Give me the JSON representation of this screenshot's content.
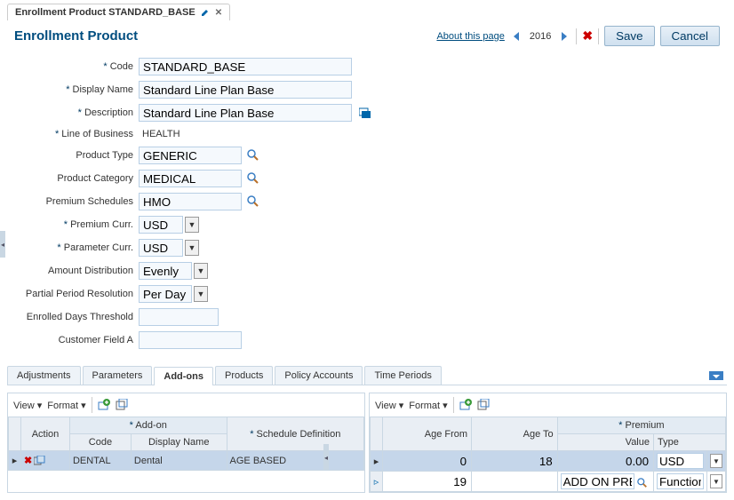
{
  "tab": {
    "title": "Enrollment Product STANDARD_BASE"
  },
  "header": {
    "title": "Enrollment Product",
    "about": "About this page",
    "year": "2016",
    "save": "Save",
    "cancel": "Cancel"
  },
  "form": {
    "code": {
      "label": "Code",
      "value": "STANDARD_BASE"
    },
    "display_name": {
      "label": "Display Name",
      "value": "Standard Line Plan Base"
    },
    "description": {
      "label": "Description",
      "value": "Standard Line Plan Base"
    },
    "lob": {
      "label": "Line of Business",
      "value": "HEALTH"
    },
    "product_type": {
      "label": "Product Type",
      "value": "GENERIC"
    },
    "product_category": {
      "label": "Product Category",
      "value": "MEDICAL"
    },
    "premium_schedules": {
      "label": "Premium Schedules",
      "value": "HMO"
    },
    "premium_curr": {
      "label": "Premium Curr.",
      "value": "USD"
    },
    "parameter_curr": {
      "label": "Parameter Curr.",
      "value": "USD"
    },
    "amount_dist": {
      "label": "Amount Distribution",
      "value": "Evenly"
    },
    "ppr": {
      "label": "Partial Period Resolution",
      "value": "Per Day"
    },
    "edt": {
      "label": "Enrolled Days Threshold",
      "value": ""
    },
    "cfa": {
      "label": "Customer Field A",
      "value": ""
    }
  },
  "subtabs": [
    "Adjustments",
    "Parameters",
    "Add-ons",
    "Products",
    "Policy Accounts",
    "Time Periods"
  ],
  "active_subtab": "Add-ons",
  "left_grid": {
    "toolbar": {
      "view": "View",
      "format": "Format"
    },
    "headers": {
      "action": "Action",
      "addon_group": "Add-on",
      "code": "Code",
      "display_name": "Display Name",
      "schedule": "Schedule Definition"
    },
    "rows": [
      {
        "code": "DENTAL",
        "display_name": "Dental",
        "schedule": "AGE BASED"
      }
    ]
  },
  "right_grid": {
    "toolbar": {
      "view": "View",
      "format": "Format"
    },
    "headers": {
      "age_from": "Age From",
      "age_to": "Age To",
      "premium_group": "Premium",
      "value": "Value",
      "type": "Type"
    },
    "rows": [
      {
        "age_from": "0",
        "age_to": "18",
        "value": "0.00",
        "type": "USD"
      },
      {
        "age_from": "19",
        "age_to": "",
        "value": "ADD ON PREM",
        "type": "Function"
      }
    ]
  }
}
